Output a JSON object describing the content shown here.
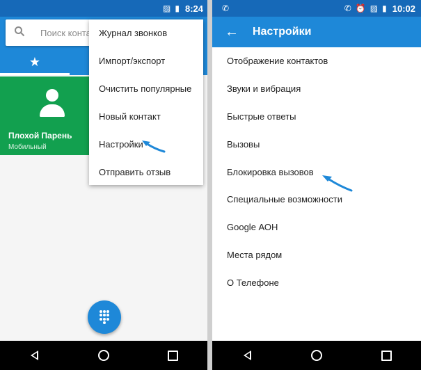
{
  "left": {
    "status": {
      "time": "8:24"
    },
    "search": {
      "placeholder": "Поиск конта"
    },
    "tabs": [
      {
        "icon": "star-icon",
        "label": "★"
      }
    ],
    "contact": {
      "name": "Плохой Парень",
      "type": "Мобильный"
    },
    "menu": [
      "Журнал звонков",
      "Импорт/экспорт",
      "Очистить популярные",
      "Новый контакт",
      "Настройки",
      "Отправить отзыв"
    ],
    "fab": {
      "icon": "dialpad-icon"
    }
  },
  "right": {
    "status": {
      "time": "10:02"
    },
    "title": "Настройки",
    "items": [
      "Отображение контактов",
      "Звуки и вибрация",
      "Быстрые ответы",
      "Вызовы",
      "Блокировка вызовов",
      "Специальные возможности",
      "Google АОН",
      "Места рядом",
      "О Телефоне"
    ]
  },
  "colors": {
    "appbar": "#1e88d8",
    "statusbar": "#1669b8",
    "contact_card": "#12a04f",
    "pointer": "#1e88d8"
  }
}
